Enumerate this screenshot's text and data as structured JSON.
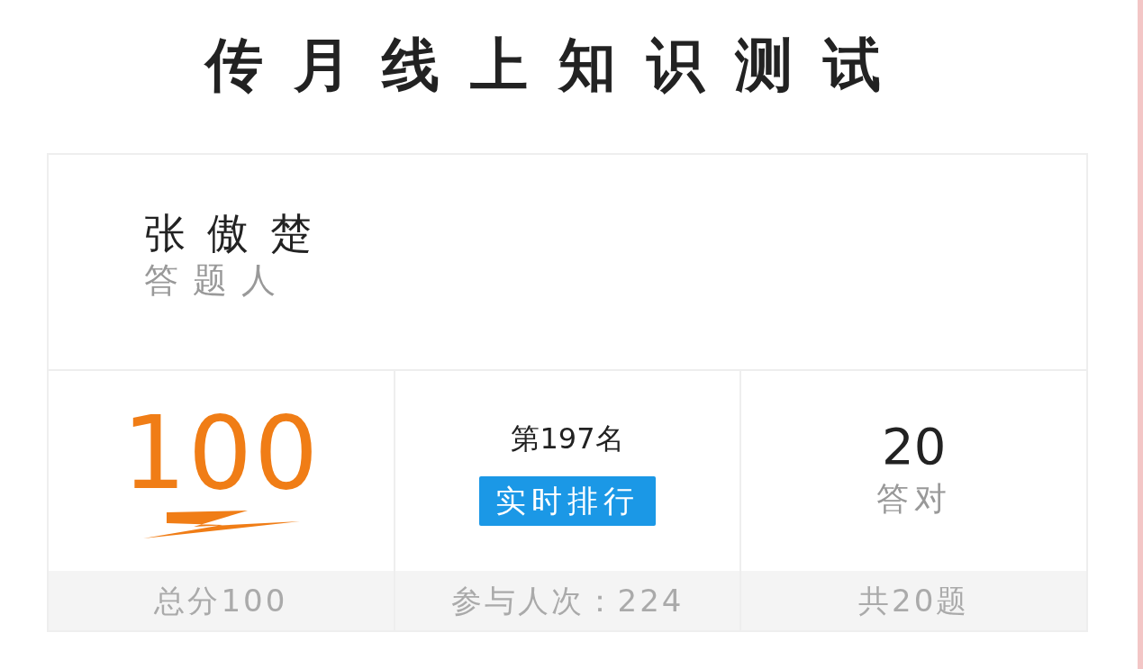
{
  "title": "传月线上知识测试",
  "respondent": {
    "name": "张傲楚",
    "label": "答题人"
  },
  "stats": [
    {
      "kind": "score",
      "value": "100",
      "footer": "总分100"
    },
    {
      "kind": "rank",
      "value": "第197名",
      "button": "实时排行",
      "footer": "参与人次：224"
    },
    {
      "kind": "count",
      "value": "20",
      "label": "答对",
      "footer": "共20题"
    }
  ]
}
